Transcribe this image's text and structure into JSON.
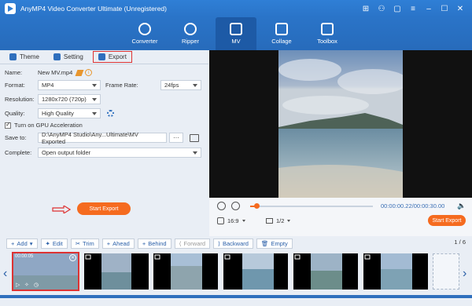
{
  "title": "AnyMP4 Video Converter Ultimate (Unregistered)",
  "nav": [
    {
      "label": "Converter",
      "active": false
    },
    {
      "label": "Ripper",
      "active": false
    },
    {
      "label": "MV",
      "active": true
    },
    {
      "label": "Collage",
      "active": false
    },
    {
      "label": "Toolbox",
      "active": false
    }
  ],
  "tabs": [
    "Theme",
    "Setting",
    "Export"
  ],
  "fields": {
    "name_label": "Name:",
    "name_value": "New MV.mp4",
    "format_label": "Format:",
    "format_value": "MP4",
    "framerate_label": "Frame Rate:",
    "framerate_value": "24fps",
    "resolution_label": "Resolution:",
    "resolution_value": "1280x720 (720p)",
    "quality_label": "Quality:",
    "quality_value": "High Quality",
    "gpu_label": "Turn on GPU Acceleration",
    "save_label": "Save to:",
    "save_value": "D:\\AnyMP4 Studio\\Any...Ultimate\\MV Exported",
    "save_dots": "···",
    "complete_label": "Complete:",
    "complete_value": "Open output folder"
  },
  "start_export": "Start Export",
  "player": {
    "time": "00:00:00.22/00:00:30.00",
    "progress": 0.05,
    "ratio": "16:9",
    "fraction": "1/2",
    "export": "Start Export"
  },
  "toolbar": {
    "add": "Add",
    "edit": "Edit",
    "trim": "Trim",
    "ahead": "Ahead",
    "behind": "Behind",
    "forward": "Forward",
    "backward": "Backward",
    "empty": "Empty",
    "page": "1 / 6"
  },
  "timeline": {
    "first_duration": "00:00:05"
  }
}
